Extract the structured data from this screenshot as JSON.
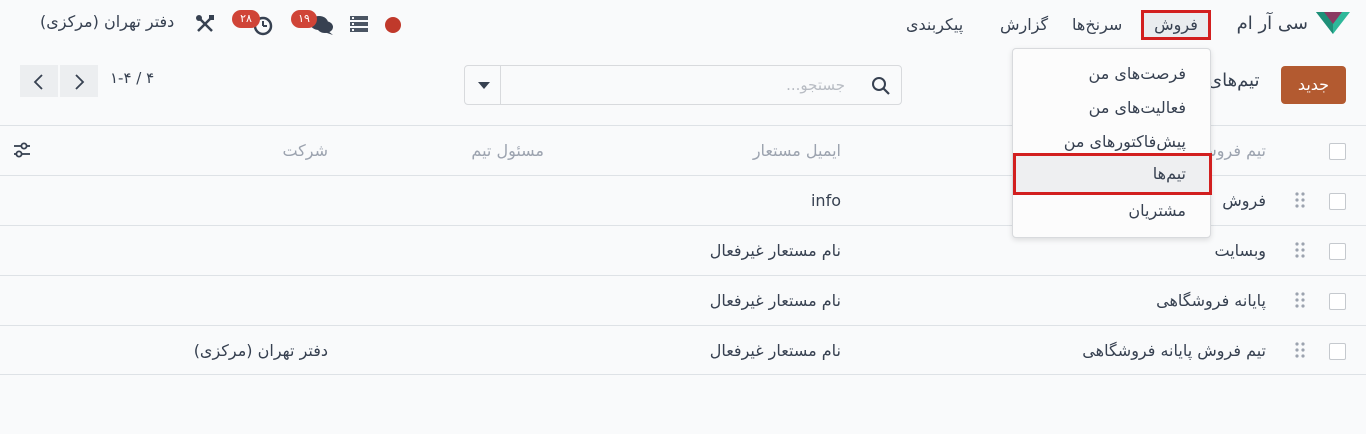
{
  "navbar": {
    "app_name": "سی آر ام",
    "menus": {
      "sales": "فروش",
      "config": "سرنخ‌ها",
      "report": "گزارش",
      "classify": "پیکربندی"
    },
    "chat_badge": "۱۹",
    "activity_badge": "۲۸",
    "company": "دفتر تهران (مرکزی)"
  },
  "control": {
    "new_button": "جدید",
    "page_title": "تیم‌های",
    "search_placeholder": "جستجو...",
    "pager_value": "۱-۴ / ۴"
  },
  "table": {
    "headers": {
      "name": "تیم فروش",
      "email": "ایمیل مستعار",
      "leader": "مسئول تیم",
      "company": "شرکت"
    },
    "rows": [
      {
        "name": "فروش",
        "email": "info",
        "leader": "",
        "company": ""
      },
      {
        "name": "وبسایت",
        "email": "نام مستعار غیرفعال",
        "leader": "",
        "company": ""
      },
      {
        "name": "پایانه فروشگاهی",
        "email": "نام مستعار غیرفعال",
        "leader": "",
        "company": ""
      },
      {
        "name": "تیم فروش پایانه فروشگاهی",
        "email": "نام مستعار غیرفعال",
        "leader": "",
        "company": "دفتر تهران (مرکزی)"
      }
    ]
  },
  "dropdown": {
    "items": [
      "فرصت‌های من",
      "فعالیت‌های من",
      "پیش‌فاکتورهای من",
      "تیم‌ها",
      "مشتریان"
    ]
  },
  "colors": {
    "brand_button": "#b35a30",
    "highlight_border": "#d21f1f",
    "badge": "#d04437"
  }
}
